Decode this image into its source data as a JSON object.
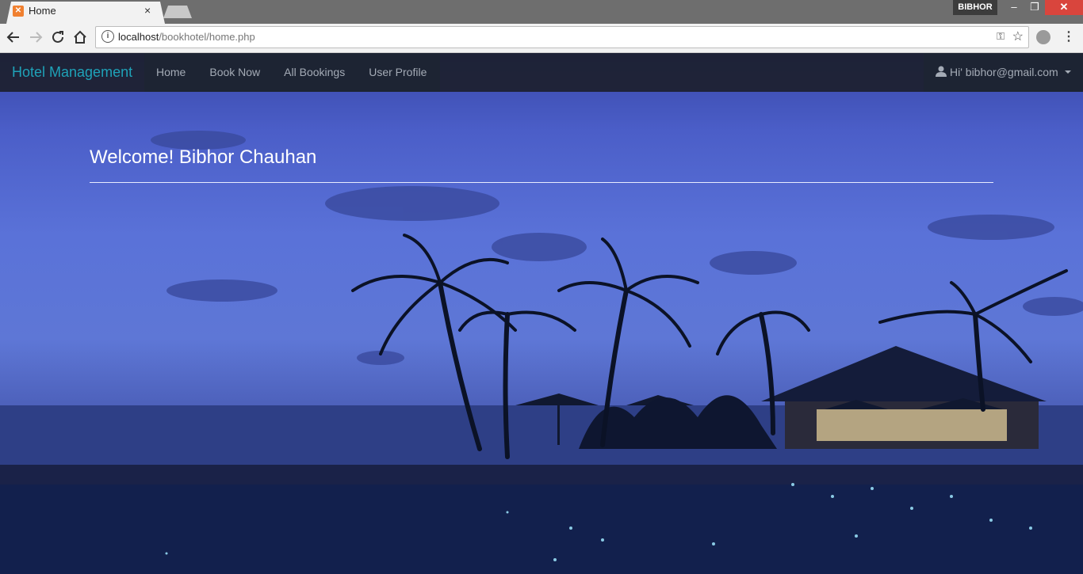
{
  "browser": {
    "tab_title": "Home",
    "tab_close": "×",
    "profile_name": "BIBHOR",
    "window_min": "–",
    "window_max": "❐",
    "window_close": "✕",
    "url_host": "localhost",
    "url_path": "/bookhotel/home.php",
    "icons": [
      "back-icon",
      "forward-icon",
      "reload-icon",
      "home-icon",
      "info-icon",
      "key-icon",
      "star-icon",
      "extension-icon",
      "menu-icon"
    ]
  },
  "navbar": {
    "brand": "Hotel Management",
    "links": [
      "Home",
      "Book Now",
      "All Bookings",
      "User Profile"
    ],
    "user_label": "Hi' bibhor@gmail.com"
  },
  "main": {
    "welcome": "Welcome! Bibhor Chauhan"
  },
  "colors": {
    "brand": "#1fa2b8",
    "navbar_bg": "#1c202e",
    "nav_text": "#a4abb6",
    "close_button": "#d9453d"
  }
}
